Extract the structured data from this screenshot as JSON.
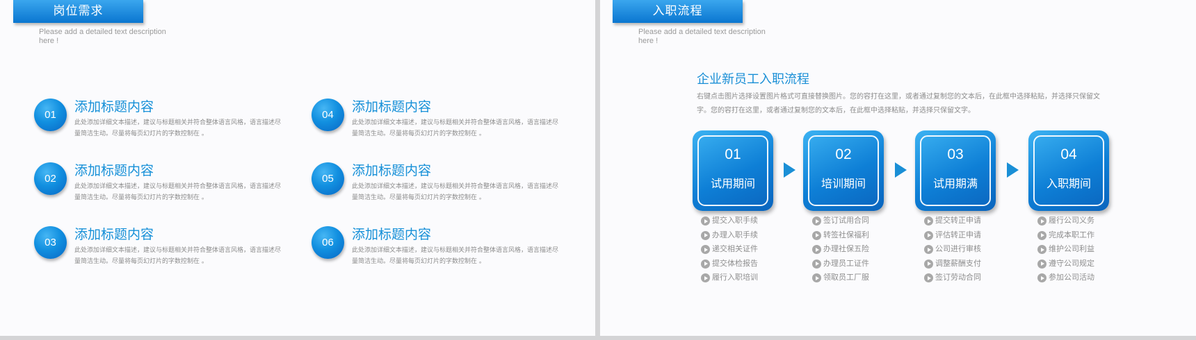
{
  "left": {
    "title": "岗位需求",
    "subtitle": "Please add a detailed text description here !",
    "items": [
      {
        "num": "01",
        "title": "添加标题内容",
        "desc": "此处添加详细文本描述，建议与标题相关并符合整体语言风格，语言描述尽量简洁生动。尽量将每页幻灯片的字数控制在 。"
      },
      {
        "num": "02",
        "title": "添加标题内容",
        "desc": "此处添加详细文本描述，建议与标题相关并符合整体语言风格，语言描述尽量简洁生动。尽量将每页幻灯片的字数控制在 。"
      },
      {
        "num": "03",
        "title": "添加标题内容",
        "desc": "此处添加详细文本描述，建议与标题相关并符合整体语言风格，语言描述尽量简洁生动。尽量将每页幻灯片的字数控制在 。"
      },
      {
        "num": "04",
        "title": "添加标题内容",
        "desc": "此处添加详细文本描述，建议与标题相关并符合整体语言风格，语言描述尽量简洁生动。尽量将每页幻灯片的字数控制在 。"
      },
      {
        "num": "05",
        "title": "添加标题内容",
        "desc": "此处添加详细文本描述，建议与标题相关并符合整体语言风格，语言描述尽量简洁生动。尽量将每页幻灯片的字数控制在 。"
      },
      {
        "num": "06",
        "title": "添加标题内容",
        "desc": "此处添加详细文本描述，建议与标题相关并符合整体语言风格，语言描述尽量简洁生动。尽量将每页幻灯片的字数控制在 。"
      }
    ]
  },
  "right": {
    "title": "入职流程",
    "subtitle": "Please add a detailed text description here !",
    "heading": "企业新员工入职流程",
    "desc": "右键点击图片选择设置图片格式可直接替换图片。您的容打在这里，或者通过复制您的文本后，在此框中选择粘贴，并选择只保留文字。您的容打在这里，或者通过复制您的文本后，在此框中选择粘贴，并选择只保留文字。",
    "steps": [
      {
        "num": "01",
        "name": "试用期间",
        "tasks": [
          "提交入职手续",
          "办理入职手续",
          "递交相关证件",
          "提交体检报告",
          "履行入职培训"
        ]
      },
      {
        "num": "02",
        "name": "培训期间",
        "tasks": [
          "签订试用合同",
          "转签社保福利",
          "办理社保五险",
          "办理员工证件",
          "领取员工厂服"
        ]
      },
      {
        "num": "03",
        "name": "试用期满",
        "tasks": [
          "提交转正申请",
          "评估转正申请",
          "公司进行审核",
          "调整薪酬支付",
          "签订劳动合同"
        ]
      },
      {
        "num": "04",
        "name": "入职期间",
        "tasks": [
          "履行公司义务",
          "完成本职工作",
          "维护公司利益",
          "遵守公司规定",
          "参加公司活动"
        ]
      }
    ]
  },
  "colors": {
    "accent": "#1a8fd6",
    "tab_top": "#3aa6ee",
    "tab_bottom": "#0a76d0",
    "muted_text": "#8c8c8c"
  },
  "icons": {
    "task_bullet": "play-circle-icon",
    "step_connector": "triangle-right-icon"
  }
}
